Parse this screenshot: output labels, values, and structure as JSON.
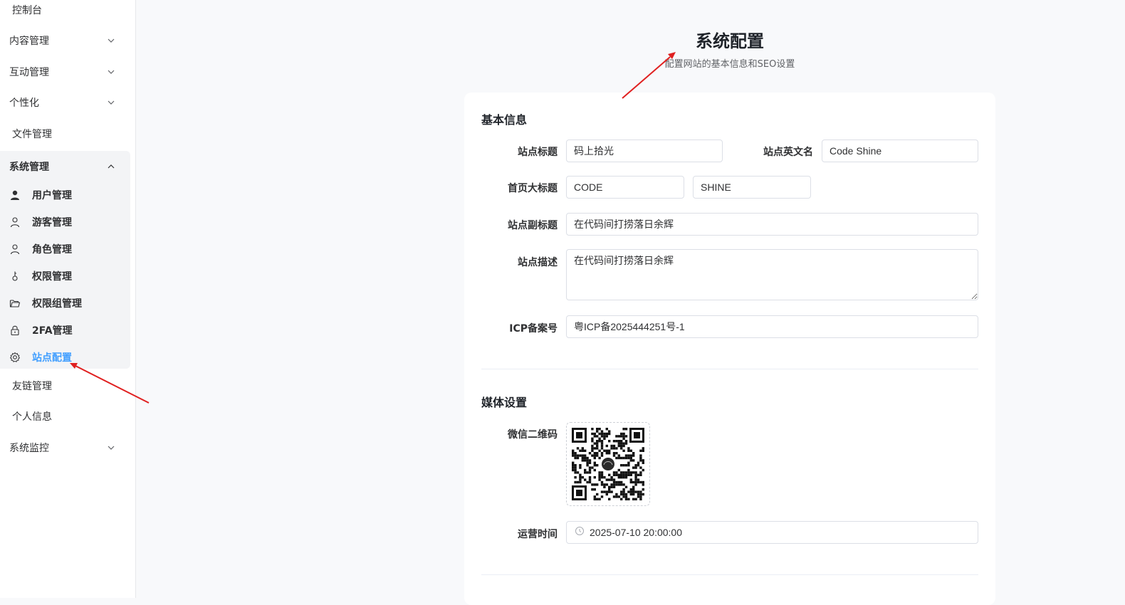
{
  "sidebar": {
    "items": [
      {
        "label": "控制台"
      },
      {
        "label": "内容管理"
      },
      {
        "label": "互动管理"
      },
      {
        "label": "个性化"
      },
      {
        "label": "文件管理"
      },
      {
        "label": "系统管理"
      },
      {
        "label": "友链管理"
      },
      {
        "label": "个人信息"
      },
      {
        "label": "系统监控"
      }
    ],
    "system_children": [
      {
        "label": "用户管理",
        "icon": "user-filled-icon"
      },
      {
        "label": "游客管理",
        "icon": "user-icon"
      },
      {
        "label": "角色管理",
        "icon": "user-icon"
      },
      {
        "label": "权限管理",
        "icon": "key-icon"
      },
      {
        "label": "权限组管理",
        "icon": "folder-icon"
      },
      {
        "label": "2FA管理",
        "icon": "lock-icon"
      },
      {
        "label": "站点配置",
        "icon": "gear-icon",
        "active": true
      }
    ]
  },
  "page": {
    "title": "系统配置",
    "subtitle": "配置网站的基本信息和SEO设置"
  },
  "basic": {
    "section_title": "基本信息",
    "site_title_label": "站点标题",
    "site_title_value": "码上拾光",
    "site_en_label": "站点英文名",
    "site_en_value": "Code Shine",
    "home_title_label": "首页大标题",
    "home_title_1": "CODE",
    "home_title_2": "SHINE",
    "subtitle_label": "站点副标题",
    "subtitle_value": "在代码间打捞落日余辉",
    "desc_label": "站点描述",
    "desc_value": "在代码间打捞落日余辉",
    "icp_label": "ICP备案号",
    "icp_value": "粤ICP备2025444251号-1"
  },
  "media": {
    "section_title": "媒体设置",
    "wechat_label": "微信二维码",
    "time_label": "运营时间",
    "time_value": "2025-07-10 20:00:00"
  },
  "colors": {
    "accent": "#409eff",
    "annotation": "#e02020"
  }
}
